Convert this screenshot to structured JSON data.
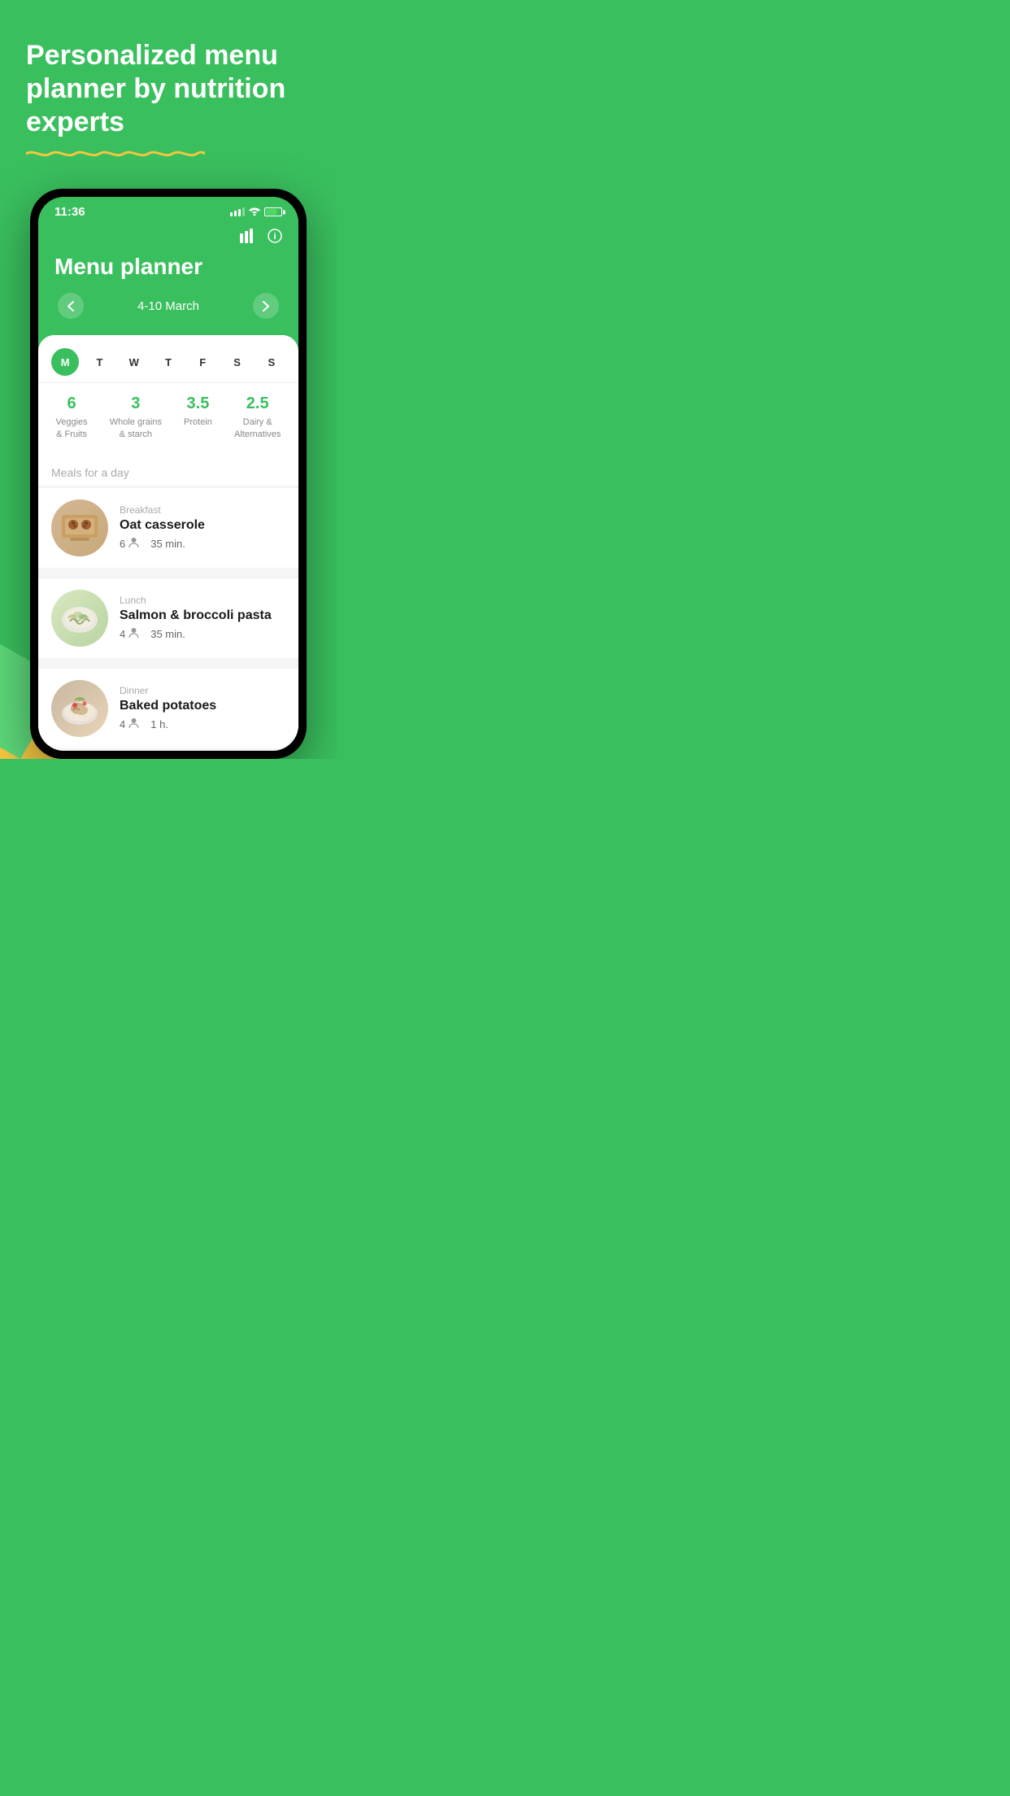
{
  "hero": {
    "title": "Personalized menu planner by nutrition experts",
    "wavy_line_color": "#f5c842"
  },
  "phone": {
    "status_bar": {
      "time": "11:36"
    },
    "app": {
      "title": "Menu planner",
      "week_range": "4-10 March",
      "stats_icon_label": "stats-icon",
      "info_icon_label": "info-icon"
    },
    "days": [
      {
        "label": "M",
        "active": true
      },
      {
        "label": "T",
        "active": false
      },
      {
        "label": "W",
        "active": false
      },
      {
        "label": "T",
        "active": false
      },
      {
        "label": "F",
        "active": false
      },
      {
        "label": "S",
        "active": false
      },
      {
        "label": "S",
        "active": false
      }
    ],
    "nutrition": [
      {
        "value": "6",
        "label": "Veggies\n& Fruits"
      },
      {
        "value": "3",
        "label": "Whole grains\n& starch"
      },
      {
        "value": "3.5",
        "label": "Protein"
      },
      {
        "value": "2.5",
        "label": "Dairy &\nAlternatives"
      }
    ],
    "meals_section_label": "Meals for a day",
    "meals": [
      {
        "type": "Breakfast",
        "name": "Oat casserole",
        "servings": "6",
        "time": "35 min.",
        "img_type": "oat"
      },
      {
        "type": "Lunch",
        "name": "Salmon & broccoli pasta",
        "servings": "4",
        "time": "35 min.",
        "img_type": "pasta"
      },
      {
        "type": "Dinner",
        "name": "Baked potatoes",
        "servings": "4",
        "time": "1 h.",
        "img_type": "potato"
      }
    ]
  }
}
